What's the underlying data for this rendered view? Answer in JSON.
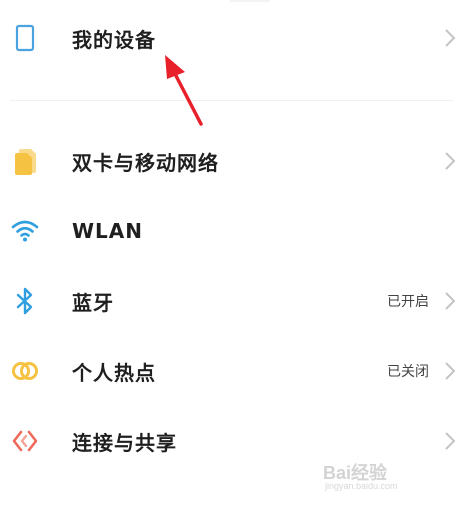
{
  "settings": {
    "items": [
      {
        "label": "我的设备",
        "status": "",
        "icon": "device-icon"
      },
      {
        "label": "双卡与移动网络",
        "status": "",
        "icon": "sim-card-icon"
      },
      {
        "label": "WLAN",
        "status": "",
        "icon": "wifi-icon"
      },
      {
        "label": "蓝牙",
        "status": "已开启",
        "icon": "bluetooth-icon"
      },
      {
        "label": "个人热点",
        "status": "已关闭",
        "icon": "hotspot-icon"
      },
      {
        "label": "连接与共享",
        "status": "",
        "icon": "connection-share-icon"
      }
    ]
  },
  "colors": {
    "device_icon": "#4aa3df",
    "sim_icon": "#f5c242",
    "wifi_icon": "#2f9fe0",
    "bluetooth_icon": "#2f9fe0",
    "hotspot_icon": "#f5c242",
    "share_icon": "#ee6a5a",
    "annotation_arrow": "#e8202a",
    "chevron": "#c4c4c4"
  },
  "watermark": {
    "brand": "Bai经验",
    "url": "jingyan.baidu.com"
  }
}
